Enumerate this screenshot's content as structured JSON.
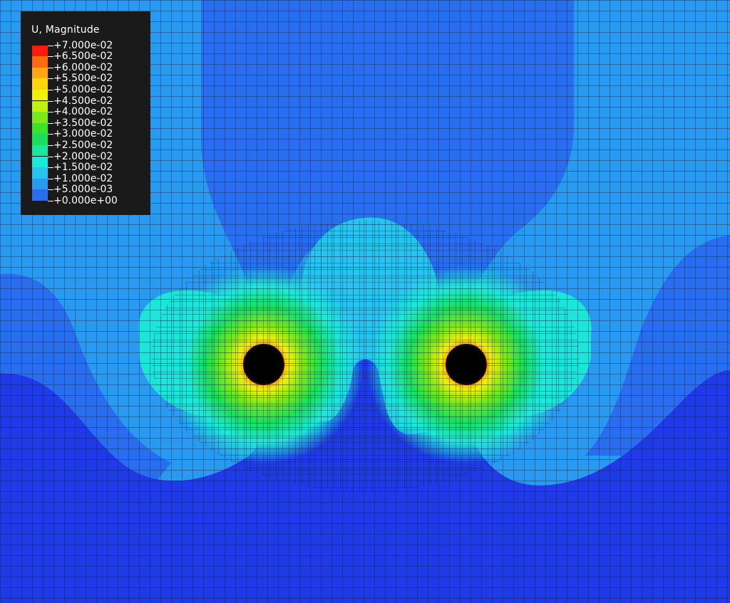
{
  "legend": {
    "title": "U, Magnitude",
    "entries": [
      {
        "label": "+7.000e-02",
        "color": "#ff1a10"
      },
      {
        "label": "+6.500e-02",
        "color": "#ff6a10"
      },
      {
        "label": "+6.000e-02",
        "color": "#ffa612"
      },
      {
        "label": "+5.500e-02",
        "color": "#ffd60e"
      },
      {
        "label": "+5.000e-02",
        "color": "#f0f00a"
      },
      {
        "label": "+4.500e-02",
        "color": "#bef012"
      },
      {
        "label": "+4.000e-02",
        "color": "#7ee81a"
      },
      {
        "label": "+3.500e-02",
        "color": "#3ee22a"
      },
      {
        "label": "+3.000e-02",
        "color": "#1cde5e"
      },
      {
        "label": "+2.500e-02",
        "color": "#1ee6a0"
      },
      {
        "label": "+2.000e-02",
        "color": "#1ee8d8"
      },
      {
        "label": "+1.500e-02",
        "color": "#28c4f0"
      },
      {
        "label": "+1.000e-02",
        "color": "#2a9af0"
      },
      {
        "label": "+5.000e-03",
        "color": "#2a6ef0"
      },
      {
        "label": "+0.000e+00",
        "color": "#1f3ae6"
      }
    ]
  },
  "colors": {
    "mesh_line": "#0a1a3a",
    "hole_fill": "#000000"
  }
}
